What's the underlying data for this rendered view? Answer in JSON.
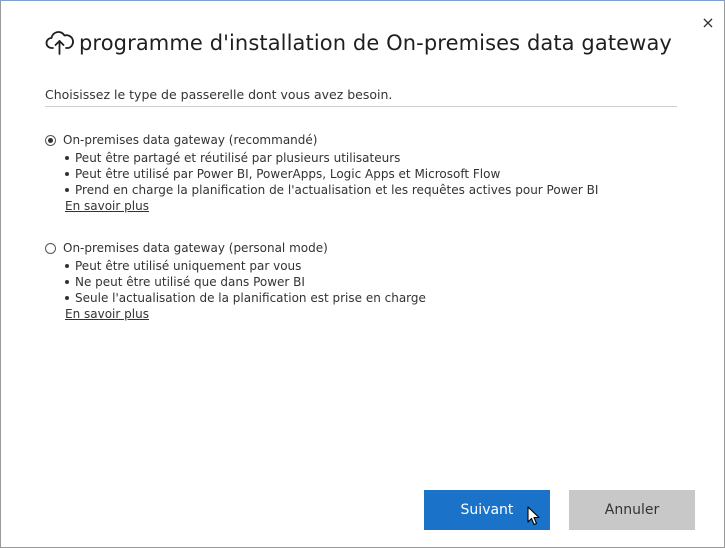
{
  "window": {
    "close_glyph": "×",
    "title": "programme d'installation de On-premises data gateway",
    "title_icon": "cloud-upload-icon"
  },
  "subtitle": "Choisissez le type de passerelle dont vous avez besoin.",
  "options": [
    {
      "label": "On-premises data gateway (recommandé)",
      "selected": true,
      "bullets": [
        "Peut être partagé et réutilisé par plusieurs utilisateurs",
        "Peut être utilisé par Power BI, PowerApps, Logic Apps et Microsoft Flow",
        "Prend en charge la planification de l'actualisation et les requêtes actives pour Power BI"
      ],
      "learn_more": "En savoir plus"
    },
    {
      "label": "On-premises data gateway (personal mode)",
      "selected": false,
      "bullets": [
        "Peut être utilisé uniquement par vous",
        "Ne peut être utilisé que dans Power BI",
        "Seule l'actualisation de la planification est prise en charge"
      ],
      "learn_more": "En savoir plus"
    }
  ],
  "buttons": {
    "next_label": "Suivant",
    "cancel_label": "Annuler"
  },
  "colors": {
    "primary_button": "#1a73c8",
    "secondary_button": "#c8c8c8"
  }
}
